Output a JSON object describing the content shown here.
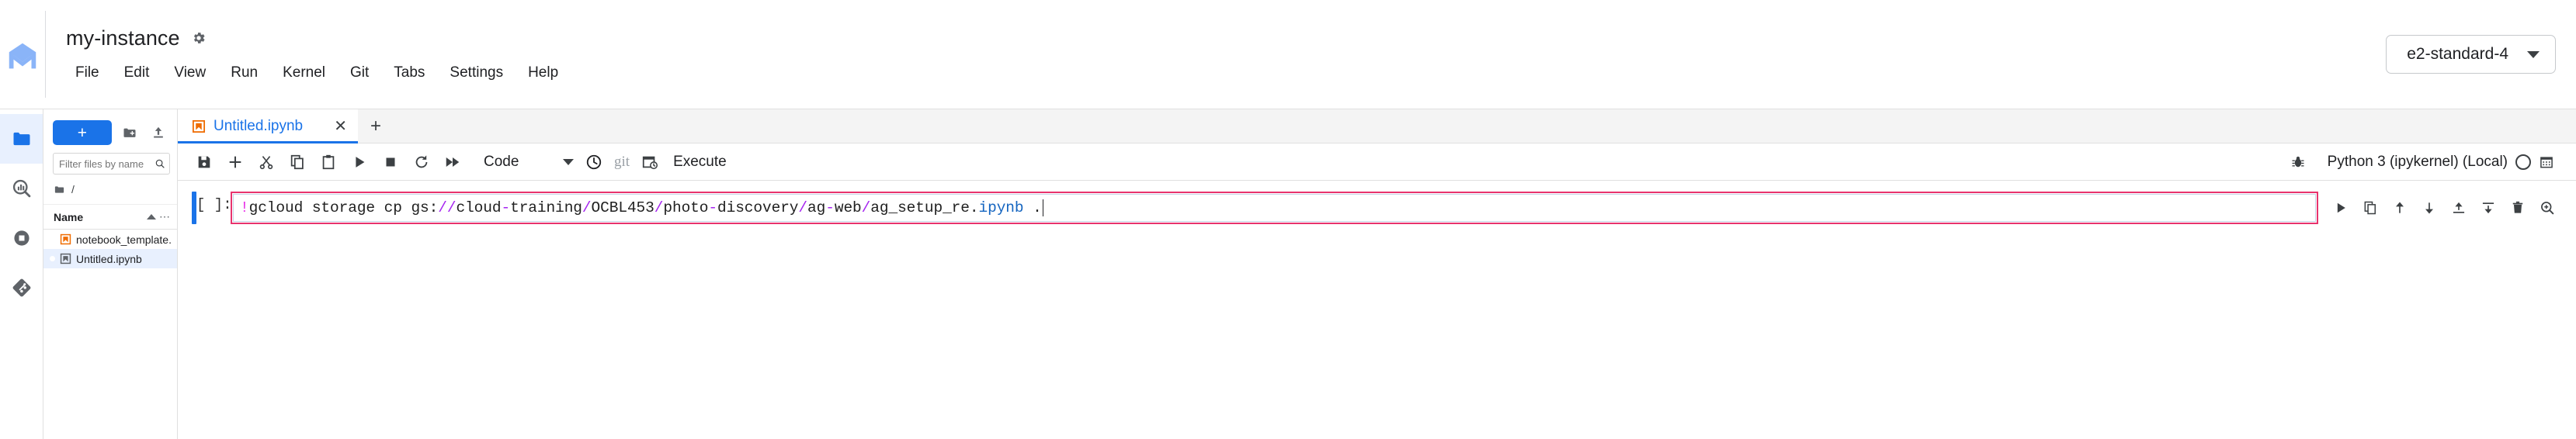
{
  "topbar": {
    "logo_icon": "vertex-ai-logo-icon",
    "instance_name": "my-instance",
    "settings_icon": "gear-icon",
    "menu": [
      {
        "label": "File"
      },
      {
        "label": "Edit"
      },
      {
        "label": "View"
      },
      {
        "label": "Run"
      },
      {
        "label": "Kernel"
      },
      {
        "label": "Git"
      },
      {
        "label": "Tabs"
      },
      {
        "label": "Settings"
      },
      {
        "label": "Help"
      }
    ],
    "machine_type": {
      "value": "e2-standard-4",
      "caret_icon": "chevron-down-icon"
    }
  },
  "rail": {
    "items": [
      {
        "name": "file-browser",
        "icon": "folder-icon",
        "active": true
      },
      {
        "name": "property-inspector",
        "icon": "search-chart-icon",
        "active": false
      },
      {
        "name": "running-terminals",
        "icon": "stop-circle-icon",
        "active": false
      },
      {
        "name": "git-panel",
        "icon": "git-icon",
        "active": false
      }
    ]
  },
  "browser": {
    "new_button_label": "+",
    "new_folder_icon": "new-folder-icon",
    "upload_icon": "upload-icon",
    "filter_placeholder": "Filter files by name",
    "filter_value": "",
    "search_icon": "search-icon",
    "breadcrumb": {
      "folder_icon": "folder-icon",
      "path": "/"
    },
    "columns": {
      "name": "Name",
      "sort_icon": "sort-ascending-icon",
      "more": "⋯"
    },
    "files": [
      {
        "name": "notebook_template....",
        "icon": "notebook-icon-orange",
        "selected": false,
        "modified": false
      },
      {
        "name": "Untitled.ipynb",
        "icon": "notebook-icon-gray",
        "selected": true,
        "modified": true
      }
    ]
  },
  "notebook": {
    "tab": {
      "icon": "notebook-icon-orange",
      "label": "Untitled.ipynb",
      "close_icon": "close-icon"
    },
    "add_tab_icon": "plus-icon",
    "toolbar": {
      "icons": [
        {
          "name": "save-button",
          "icon": "save-icon"
        },
        {
          "name": "insert-cell-button",
          "icon": "plus-icon"
        },
        {
          "name": "cut-cells-button",
          "icon": "scissors-icon"
        },
        {
          "name": "copy-cells-button",
          "icon": "copy-icon"
        },
        {
          "name": "paste-cells-button",
          "icon": "paste-icon"
        },
        {
          "name": "run-cell-button",
          "icon": "play-icon"
        },
        {
          "name": "interrupt-kernel-button",
          "icon": "stop-square-icon"
        },
        {
          "name": "restart-kernel-button",
          "icon": "restart-icon"
        },
        {
          "name": "restart-run-all-button",
          "icon": "fast-forward-icon"
        }
      ],
      "cell_type": "Code",
      "cell_type_caret": "chevron-down-icon",
      "history_icon": "clock-icon",
      "git_label": "git",
      "schedule_icon": "calendar-clock-icon",
      "execute_label": "Execute",
      "debugger_icon": "bug-icon",
      "kernel_name": "Python 3 (ipykernel) (Local)",
      "kernel_status_icon": "kernel-idle-circle-icon",
      "calendar_icon": "calendar-icon"
    },
    "cell": {
      "prompt": "[ ]:",
      "code_tokens": [
        {
          "t": "!",
          "c": "cm-bang"
        },
        {
          "t": "gcloud storage cp gs:",
          "c": ""
        },
        {
          "t": "//",
          "c": "cm-op"
        },
        {
          "t": "cloud",
          "c": ""
        },
        {
          "t": "-",
          "c": "cm-op"
        },
        {
          "t": "training",
          "c": ""
        },
        {
          "t": "/",
          "c": "cm-op"
        },
        {
          "t": "OCBL453",
          "c": ""
        },
        {
          "t": "/",
          "c": "cm-op"
        },
        {
          "t": "photo",
          "c": ""
        },
        {
          "t": "-",
          "c": "cm-op"
        },
        {
          "t": "discovery",
          "c": ""
        },
        {
          "t": "/",
          "c": "cm-op"
        },
        {
          "t": "ag",
          "c": ""
        },
        {
          "t": "-",
          "c": "cm-op"
        },
        {
          "t": "web",
          "c": ""
        },
        {
          "t": "/",
          "c": "cm-op"
        },
        {
          "t": "ag_setup_re.",
          "c": ""
        },
        {
          "t": "ipynb",
          "c": "cm-ext"
        },
        {
          "t": " .",
          "c": ""
        }
      ],
      "code_plain": "!gcloud storage cp gs://cloud-training/OCBL453/photo-discovery/ag-web/ag_setup_re.ipynb .",
      "highlight_color": "#e8336d",
      "actions": [
        {
          "name": "run-cell-action",
          "icon": "play-icon"
        },
        {
          "name": "duplicate-cell-action",
          "icon": "duplicate-icon"
        },
        {
          "name": "move-cell-up-action",
          "icon": "arrow-up-icon"
        },
        {
          "name": "move-cell-down-action",
          "icon": "arrow-down-icon"
        },
        {
          "name": "insert-cell-above-action",
          "icon": "insert-above-icon"
        },
        {
          "name": "insert-cell-below-action",
          "icon": "insert-below-icon"
        },
        {
          "name": "delete-cell-action",
          "icon": "trash-icon"
        },
        {
          "name": "search-cell-action",
          "icon": "zoom-icon"
        }
      ]
    }
  },
  "colors": {
    "accent_blue": "#1a73e8",
    "highlight_pink": "#e8336d",
    "notebook_orange": "#ef6c00",
    "selected_row": "#e8f0fe"
  }
}
